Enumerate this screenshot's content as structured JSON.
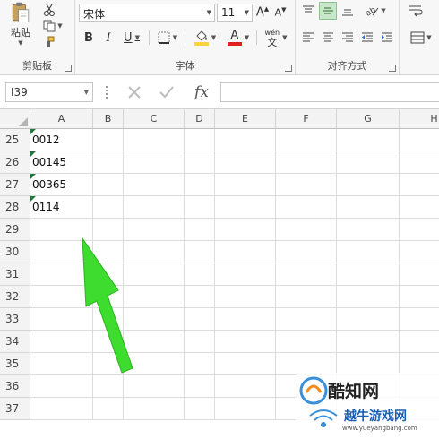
{
  "ribbon": {
    "clipboard": {
      "paste_label": "粘贴",
      "group_label": "剪贴板"
    },
    "font": {
      "font_name": "宋体",
      "font_size": "11",
      "bold": "B",
      "italic": "I",
      "underline": "U",
      "font_color_letter": "A",
      "highlight_color": "#ffd23f",
      "font_color": "#e02020",
      "phonetic_top": "wén",
      "phonetic_bottom": "文",
      "group_label": "字体"
    },
    "alignment": {
      "group_label": "对齐方式"
    }
  },
  "formula_bar": {
    "name_box": "I39",
    "fx_label": "fx",
    "formula": ""
  },
  "sheet": {
    "columns": [
      "A",
      "B",
      "C",
      "D",
      "E",
      "F",
      "G",
      "H"
    ],
    "rows": [
      "25",
      "26",
      "27",
      "28",
      "29",
      "30",
      "31",
      "32",
      "33",
      "34",
      "35",
      "36",
      "37"
    ],
    "cells_a": [
      "0012",
      "00145",
      "00365",
      "0114",
      "",
      "",
      "",
      "",
      "",
      "",
      "",
      "",
      ""
    ],
    "error_indicator_color": "#1f7a3a"
  },
  "annotation": {
    "arrow_color": "#3ddc2e"
  },
  "watermark": {
    "brand": "酷知网",
    "site_name": "越牛游戏网",
    "url": "www.yueyangbang.com"
  }
}
